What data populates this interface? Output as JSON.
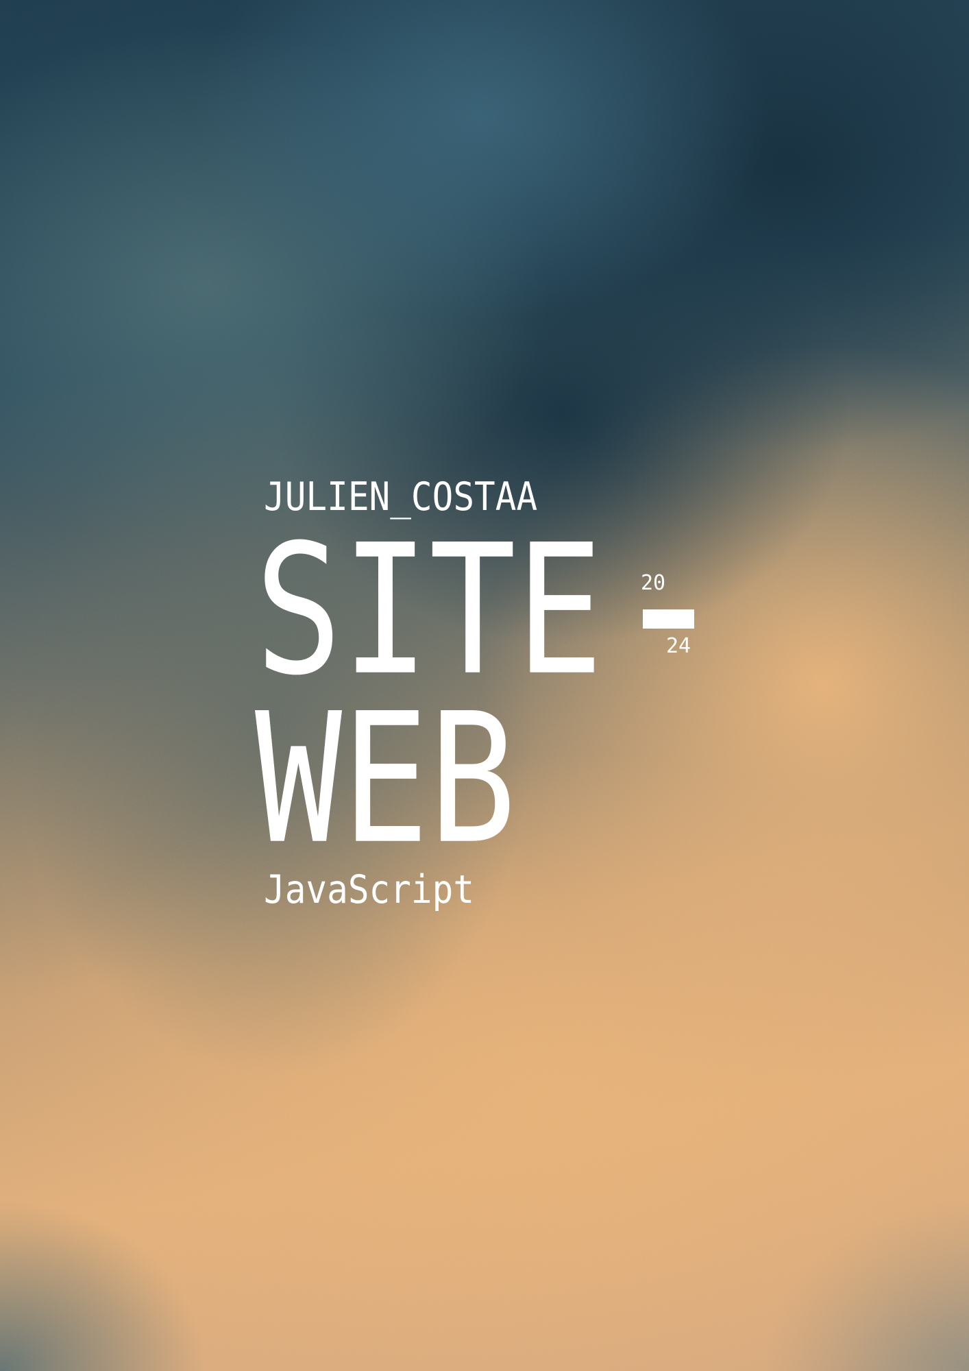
{
  "poster": {
    "author": "JULIEN_COSTAA",
    "title_line1": "SITE",
    "title_line2": "WEB",
    "subtitle": "JavaScript",
    "year_top": "20",
    "year_bottom": "24"
  },
  "colors": {
    "text": "#ffffff",
    "dark_blue": "#1f3c4d",
    "teal": "#3c6478",
    "orange": "#e6b076"
  }
}
